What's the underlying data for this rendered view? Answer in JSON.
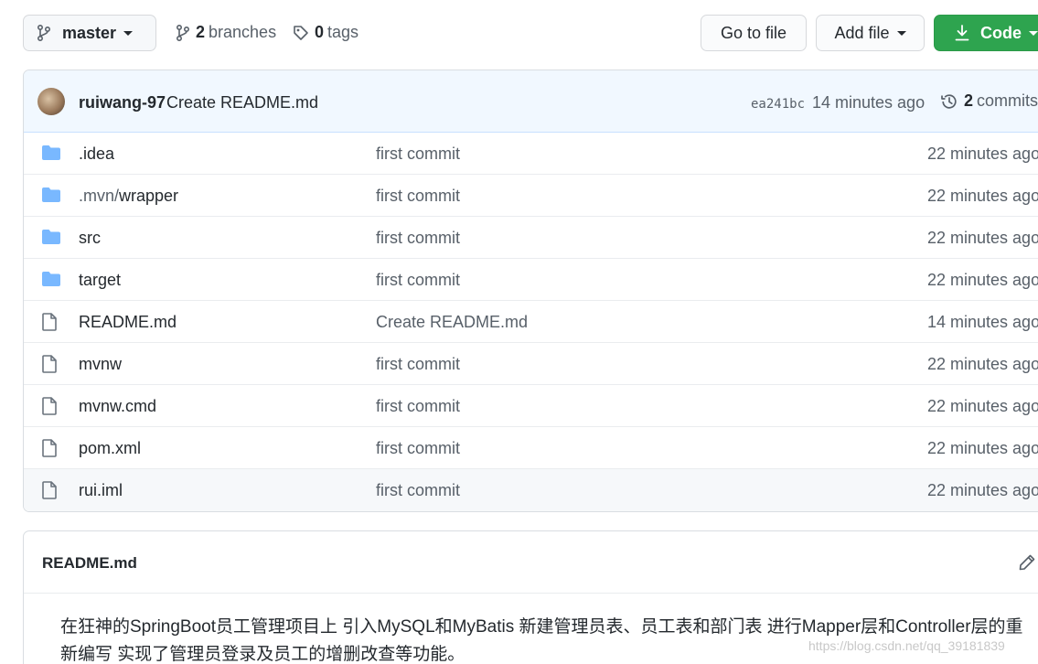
{
  "toolbar": {
    "branch_label": "master",
    "branches_count": "2",
    "branches_label": "branches",
    "tags_count": "0",
    "tags_label": "tags",
    "goto_file_label": "Go to file",
    "add_file_label": "Add file",
    "code_label": "Code"
  },
  "latest_commit": {
    "author": "ruiwang-97",
    "message": "Create README.md",
    "sha": "ea241bc",
    "time": "14 minutes ago",
    "commits_count": "2",
    "commits_label": "commits"
  },
  "files": [
    {
      "type": "folder",
      "name_dim": "",
      "name": ".idea",
      "message": "first commit",
      "time": "22 minutes ago"
    },
    {
      "type": "folder",
      "name_dim": ".mvn/",
      "name": "wrapper",
      "message": "first commit",
      "time": "22 minutes ago"
    },
    {
      "type": "folder",
      "name_dim": "",
      "name": "src",
      "message": "first commit",
      "time": "22 minutes ago"
    },
    {
      "type": "folder",
      "name_dim": "",
      "name": "target",
      "message": "first commit",
      "time": "22 minutes ago"
    },
    {
      "type": "file",
      "name_dim": "",
      "name": "README.md",
      "message": "Create README.md",
      "time": "14 minutes ago"
    },
    {
      "type": "file",
      "name_dim": "",
      "name": "mvnw",
      "message": "first commit",
      "time": "22 minutes ago"
    },
    {
      "type": "file",
      "name_dim": "",
      "name": "mvnw.cmd",
      "message": "first commit",
      "time": "22 minutes ago"
    },
    {
      "type": "file",
      "name_dim": "",
      "name": "pom.xml",
      "message": "first commit",
      "time": "22 minutes ago"
    },
    {
      "type": "file",
      "name_dim": "",
      "name": "rui.iml",
      "message": "first commit",
      "time": "22 minutes ago"
    }
  ],
  "readme": {
    "title": "README.md",
    "body": "在狂神的SpringBoot员工管理项目上 引入MySQL和MyBatis 新建管理员表、员工表和部门表 进行Mapper层和Controller层的重新编写 实现了管理员登录及员工的增删改查等功能。"
  },
  "watermark": "https://blog.csdn.net/qq_39181839",
  "colors": {
    "accent_green": "#2ea44f",
    "folder_blue": "#79b8ff",
    "commit_bar_bg": "#f1f8ff"
  },
  "icons": {
    "branch": "git-branch-icon",
    "tag": "tag-icon",
    "download": "download-icon",
    "history": "history-icon",
    "folder": "folder-icon",
    "file": "file-icon",
    "edit": "pencil-icon"
  }
}
